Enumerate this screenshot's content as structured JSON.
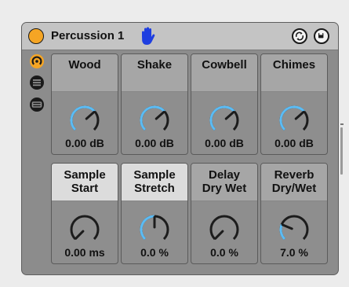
{
  "device": {
    "title": "Percussion 1",
    "accent_color": "#f5a524",
    "knob_arc_color": "#5bbcf5",
    "header_icons": [
      "hand-icon",
      "hot-swap-icon",
      "save-preset-icon"
    ],
    "sidebar_icons": [
      "macro-knobs-icon",
      "list-icon",
      "chain-icon"
    ]
  },
  "macros": [
    {
      "label": "Wood",
      "value": "0.00 dB",
      "level": 0.68
    },
    {
      "label": "Shake",
      "value": "0.00 dB",
      "level": 0.68
    },
    {
      "label": "Cowbell",
      "value": "0.00 dB",
      "level": 0.68
    },
    {
      "label": "Chimes",
      "value": "0.00 dB",
      "level": 0.68
    },
    {
      "label": "Sample\nStart",
      "value": "0.00 ms",
      "level": 0.0
    },
    {
      "label": "Sample\nStretch",
      "value": "0.0 %",
      "level": 0.5
    },
    {
      "label": "Delay\nDry Wet",
      "value": "0.0 %",
      "level": 0.0
    },
    {
      "label": "Reverb\nDry/Wet",
      "value": "7.0 %",
      "level": 0.25
    }
  ]
}
